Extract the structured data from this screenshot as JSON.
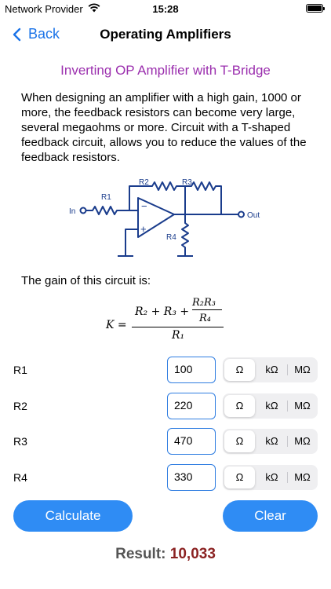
{
  "status_bar": {
    "carrier": "Network Provider",
    "time": "15:28"
  },
  "nav": {
    "back_label": "Back",
    "title": "Operating Amplifiers"
  },
  "page": {
    "title": "Inverting OP Amplifier with T-Bridge",
    "description": "When designing an amplifier with a high gain, 1000 or more, the feedback resistors can become very large, several megaohms or more. Circuit with a T-shaped feedback circuit, allows you to reduce the values of the feedback resistors.",
    "gain_label": "The gain of this circuit is:"
  },
  "circuit": {
    "labels": {
      "r1": "R1",
      "r2": "R2",
      "r3": "R3",
      "r4": "R4",
      "in": "In",
      "out": "Out",
      "minus": "−",
      "plus": "+"
    }
  },
  "formula": {
    "k": "K =",
    "num_a": "R₂ + R₃ +",
    "num_b_top": "R₂R₃",
    "num_b_bot": "R₄",
    "den": "R₁"
  },
  "units": [
    "Ω",
    "kΩ",
    "MΩ"
  ],
  "resistors": [
    {
      "label": "R1",
      "value": "100",
      "unit": "Ω"
    },
    {
      "label": "R2",
      "value": "220",
      "unit": "Ω"
    },
    {
      "label": "R3",
      "value": "470",
      "unit": "Ω"
    },
    {
      "label": "R4",
      "value": "330",
      "unit": "Ω"
    }
  ],
  "buttons": {
    "calculate": "Calculate",
    "clear": "Clear"
  },
  "result": {
    "label": "Result:",
    "value": "10,033"
  },
  "colors": {
    "accent": "#2f8cf4",
    "title": "#9b2fae",
    "circuit": "#1a3c8c",
    "result_value": "#8b2222"
  }
}
